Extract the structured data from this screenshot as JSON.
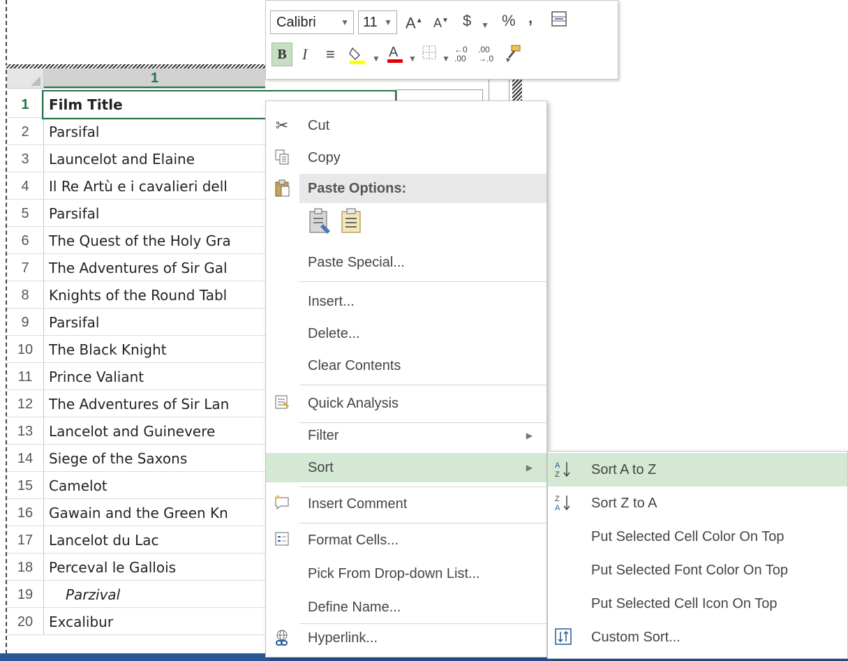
{
  "column_header": "1",
  "rows": [
    {
      "num": "1",
      "value": "Film Title"
    },
    {
      "num": "2",
      "value": "Parsifal"
    },
    {
      "num": "3",
      "value": "Launcelot and Elaine"
    },
    {
      "num": "4",
      "value": "Il Re Artù e i cavalieri dell"
    },
    {
      "num": "5",
      "value": "Parsifal"
    },
    {
      "num": "6",
      "value": "The Quest of the Holy Gra"
    },
    {
      "num": "7",
      "value": "The Adventures of Sir Gal"
    },
    {
      "num": "8",
      "value": "Knights of the Round Tabl"
    },
    {
      "num": "9",
      "value": "Parsifal"
    },
    {
      "num": "10",
      "value": "The Black Knight"
    },
    {
      "num": "11",
      "value": "Prince Valiant"
    },
    {
      "num": "12",
      "value": "The Adventures of Sir Lan"
    },
    {
      "num": "13",
      "value": "Lancelot and Guinevere"
    },
    {
      "num": "14",
      "value": "Siege of the Saxons"
    },
    {
      "num": "15",
      "value": "Camelot"
    },
    {
      "num": "16",
      "value": "Gawain and the Green Kn"
    },
    {
      "num": "17",
      "value": "Lancelot du Lac"
    },
    {
      "num": "18",
      "value": "Perceval le Gallois"
    },
    {
      "num": "19",
      "value": "Parzival"
    },
    {
      "num": "20",
      "value": "Excalibur"
    }
  ],
  "mini_toolbar": {
    "font": "Calibri",
    "size": "11",
    "bold_label": "B",
    "italic_label": "I",
    "currency": "$",
    "percent": "%",
    "comma": ","
  },
  "context_menu": {
    "cut": "Cut",
    "copy": "Copy",
    "paste_options": "Paste Options:",
    "paste_special": "Paste Special...",
    "insert": "Insert...",
    "delete": "Delete...",
    "clear_contents": "Clear Contents",
    "quick_analysis": "Quick Analysis",
    "filter": "Filter",
    "sort": "Sort",
    "insert_comment": "Insert Comment",
    "format_cells": "Format Cells...",
    "pick_from_list": "Pick From Drop-down List...",
    "define_name": "Define Name...",
    "hyperlink": "Hyperlink..."
  },
  "sort_submenu": {
    "sort_a_to_z": "Sort A to Z",
    "sort_z_to_a": "Sort Z to A",
    "cell_color": "Put Selected Cell Color On Top",
    "font_color": "Put Selected Font Color On Top",
    "cell_icon": "Put Selected Cell Icon On Top",
    "custom_sort": "Custom Sort..."
  },
  "colors": {
    "accent_green": "#217346",
    "highlight": "#d5e8d4",
    "status_bar": "#2b5797"
  }
}
